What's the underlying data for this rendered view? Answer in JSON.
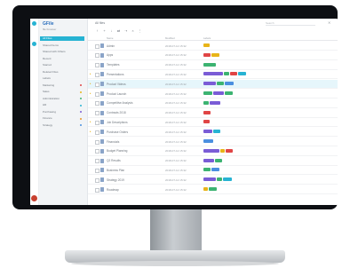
{
  "app": {
    "logo": "GFile",
    "subtitle": "file browser"
  },
  "sidebar": {
    "items": [
      {
        "label": "All Files",
        "count": "",
        "active": true,
        "color": ""
      },
      {
        "label": "Shared Items",
        "count": "",
        "active": false,
        "color": ""
      },
      {
        "label": "Shared with Others",
        "count": "",
        "active": false,
        "color": ""
      },
      {
        "label": "Recent",
        "count": "",
        "active": false,
        "color": ""
      },
      {
        "label": "Starred",
        "count": "",
        "active": false,
        "color": ""
      },
      {
        "label": "Deleted Files",
        "count": "",
        "active": false,
        "color": ""
      },
      {
        "label": "Labels",
        "count": "",
        "active": false,
        "color": ""
      },
      {
        "label": "Marketing",
        "count": "",
        "active": false,
        "color": "#e04545"
      },
      {
        "label": "Sales",
        "count": "",
        "active": false,
        "color": "#e8b418"
      },
      {
        "label": "Administration",
        "count": "",
        "active": false,
        "color": "#3cb371"
      },
      {
        "label": "HR",
        "count": "",
        "active": false,
        "color": "#27b3d3"
      },
      {
        "label": "Purchasing",
        "count": "",
        "active": false,
        "color": "#7a5cd6"
      },
      {
        "label": "Finance",
        "count": "",
        "active": false,
        "color": "#e8942a"
      },
      {
        "label": "Strategy",
        "count": "",
        "active": false,
        "color": "#4a8fe0"
      }
    ]
  },
  "main": {
    "title": "All files",
    "search_placeholder": "Search",
    "toolbar_icons": [
      "upload-icon",
      "new-folder-icon",
      "download-icon",
      "share-icon",
      "move-icon",
      "delete-icon",
      "more-icon"
    ],
    "columns": {
      "name": "Name",
      "date": "Modified",
      "tags": "Labels"
    },
    "rows": [
      {
        "name": "Admin",
        "date": "2018-07-12 15:32",
        "expand": false,
        "tags": [
          {
            "c": "#e8b418",
            "w": 7
          }
        ]
      },
      {
        "name": "Apps",
        "date": "2018-07-12 15:32",
        "expand": false,
        "tags": [
          {
            "c": "#e04545",
            "w": 8
          },
          {
            "c": "#e8b418",
            "w": 9
          }
        ]
      },
      {
        "name": "Templates",
        "date": "2018-07-12 15:32",
        "expand": false,
        "tags": [
          {
            "c": "#3cb371",
            "w": 14
          }
        ]
      },
      {
        "name": "Presentations",
        "date": "2018-07-12 15:32",
        "expand": true,
        "tags": [
          {
            "c": "#7a5cd6",
            "w": 22
          },
          {
            "c": "#3cb371",
            "w": 6
          },
          {
            "c": "#e04545",
            "w": 8
          },
          {
            "c": "#27b3d3",
            "w": 9
          }
        ]
      },
      {
        "name": "Product Videos",
        "date": "2018-07-12 15:32",
        "expand": true,
        "tags": [
          {
            "c": "#7a5cd6",
            "w": 14
          },
          {
            "c": "#3cb371",
            "w": 8
          },
          {
            "c": "#4a8fe0",
            "w": 10
          }
        ],
        "highlight": true
      },
      {
        "name": "Product Launch",
        "date": "2018-07-12 15:32",
        "expand": true,
        "tags": [
          {
            "c": "#3cb371",
            "w": 10
          },
          {
            "c": "#7a5cd6",
            "w": 12
          },
          {
            "c": "#3cb371",
            "w": 9
          }
        ]
      },
      {
        "name": "Competitive Analysis",
        "date": "2018-07-12 15:32",
        "expand": false,
        "tags": [
          {
            "c": "#3cb371",
            "w": 6
          },
          {
            "c": "#7a5cd6",
            "w": 12
          }
        ]
      },
      {
        "name": "Contracts 2018",
        "date": "2018-07-12 15:32",
        "expand": false,
        "tags": [
          {
            "c": "#e04545",
            "w": 8
          }
        ]
      },
      {
        "name": "Job Descriptions",
        "date": "2018-07-12 15:32",
        "expand": true,
        "tags": [
          {
            "c": "#e04545",
            "w": 7
          }
        ]
      },
      {
        "name": "Purchase Orders",
        "date": "2018-07-12 15:32",
        "expand": true,
        "tags": [
          {
            "c": "#7a5cd6",
            "w": 10
          },
          {
            "c": "#27b3d3",
            "w": 8
          }
        ]
      },
      {
        "name": "Financials",
        "date": "2018-07-12 15:32",
        "expand": false,
        "tags": [
          {
            "c": "#4a8fe0",
            "w": 11
          }
        ]
      },
      {
        "name": "Budget Planning",
        "date": "2018-07-12 15:32",
        "expand": false,
        "tags": [
          {
            "c": "#7a5cd6",
            "w": 18
          },
          {
            "c": "#e8b418",
            "w": 5
          },
          {
            "c": "#e04545",
            "w": 8
          }
        ]
      },
      {
        "name": "Q2 Results",
        "date": "2018-07-12 15:32",
        "expand": false,
        "tags": [
          {
            "c": "#7a5cd6",
            "w": 12
          },
          {
            "c": "#3cb371",
            "w": 8
          }
        ]
      },
      {
        "name": "Business Plan",
        "date": "2018-07-12 15:32",
        "expand": false,
        "tags": [
          {
            "c": "#3cb371",
            "w": 8
          },
          {
            "c": "#4a8fe0",
            "w": 9
          }
        ]
      },
      {
        "name": "Strategy 2019",
        "date": "2018-07-12 15:32",
        "expand": false,
        "tags": [
          {
            "c": "#7a5cd6",
            "w": 14
          },
          {
            "c": "#3cb371",
            "w": 6
          },
          {
            "c": "#27b3d3",
            "w": 10
          }
        ]
      },
      {
        "name": "Roadmap",
        "date": "2018-07-12 15:32",
        "expand": false,
        "tags": [
          {
            "c": "#e8b418",
            "w": 5
          },
          {
            "c": "#3cb371",
            "w": 9
          }
        ]
      }
    ]
  }
}
